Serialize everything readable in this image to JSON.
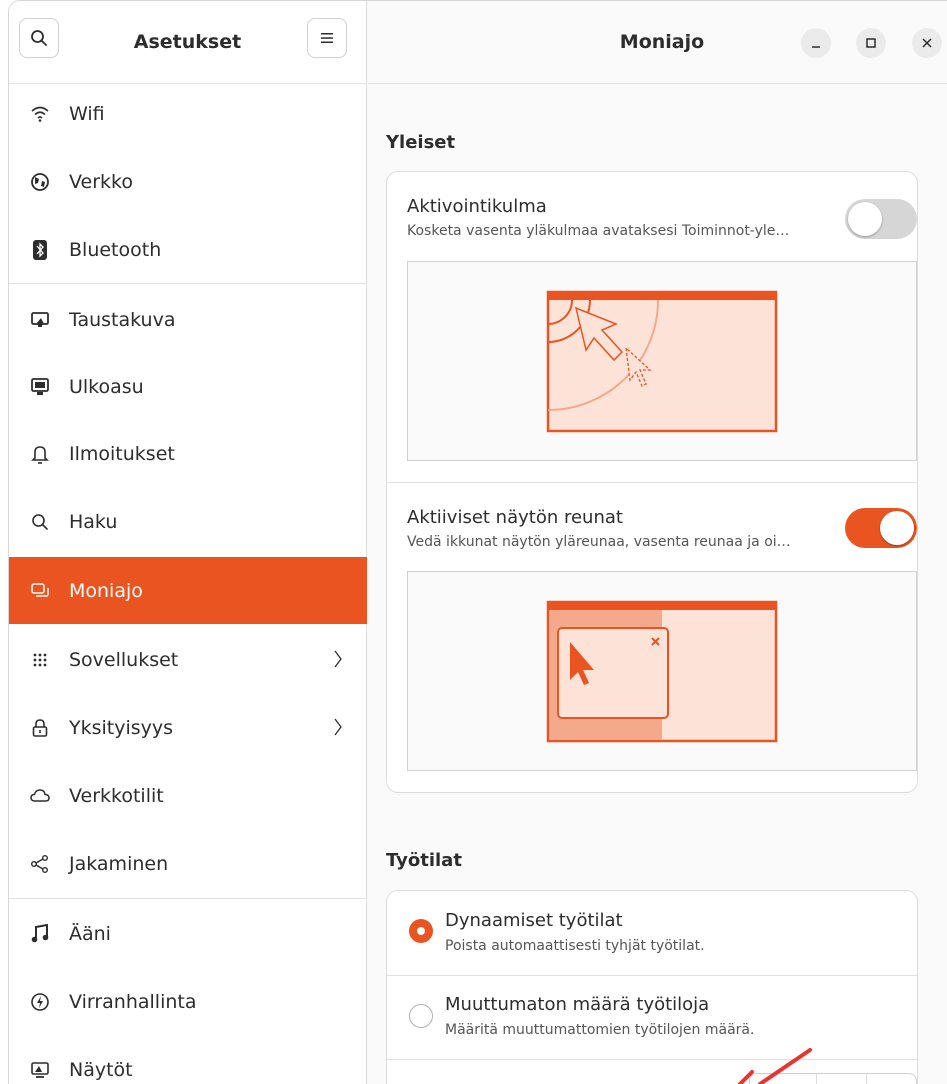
{
  "sidebar": {
    "title": "Asetukset",
    "search_icon": "search-icon",
    "menu_icon": "hamburger-menu-icon",
    "items": [
      {
        "label": "Wifi",
        "icon": "wifi-icon"
      },
      {
        "label": "Verkko",
        "icon": "network-globe-icon"
      },
      {
        "label": "Bluetooth",
        "icon": "bluetooth-icon"
      },
      {
        "label": "Taustakuva",
        "icon": "monitor-wallpaper-icon"
      },
      {
        "label": "Ulkoasu",
        "icon": "appearance-icon"
      },
      {
        "label": "Ilmoitukset",
        "icon": "bell-icon"
      },
      {
        "label": "Haku",
        "icon": "search-icon"
      },
      {
        "label": "Moniajo",
        "icon": "multitasking-icon"
      },
      {
        "label": "Sovellukset",
        "icon": "apps-grid-icon"
      },
      {
        "label": "Yksityisyys",
        "icon": "lock-icon"
      },
      {
        "label": "Verkkotilit",
        "icon": "cloud-icon"
      },
      {
        "label": "Jakaminen",
        "icon": "share-icon"
      },
      {
        "label": "Ääni",
        "icon": "music-note-icon"
      },
      {
        "label": "Virranhallinta",
        "icon": "power-icon"
      },
      {
        "label": "Näytöt",
        "icon": "display-icon"
      }
    ]
  },
  "main": {
    "title": "Moniajo",
    "window_controls": [
      "minimize-icon",
      "maximize-icon",
      "close-icon"
    ],
    "general": {
      "section_title": "Yleiset",
      "hot_corner": {
        "title": "Aktivointikulma",
        "subtitle": "Kosketa vasenta yläkulmaa avataksesi Toiminnot-yle…",
        "enabled": false
      },
      "active_edges": {
        "title": "Aktiiviset näytön reunat",
        "subtitle": "Vedä ikkunat näytön yläreunaa, vasenta reunaa ja oi…",
        "enabled": true
      }
    },
    "workspaces": {
      "section_title": "Työtilat",
      "options": [
        {
          "title": "Dynaamiset työtilat",
          "subtitle": "Poista automaattisesti tyhjät työtilat.",
          "selected": true
        },
        {
          "title": "Muuttumaton määrä työtiloja",
          "subtitle": "Määritä muuttumattomien työtilojen määrä.",
          "selected": false
        }
      ]
    }
  },
  "colors": {
    "accent": "#e95420",
    "preview_fill": "#fde2d8",
    "toggle_off": "#d6d6d6"
  }
}
